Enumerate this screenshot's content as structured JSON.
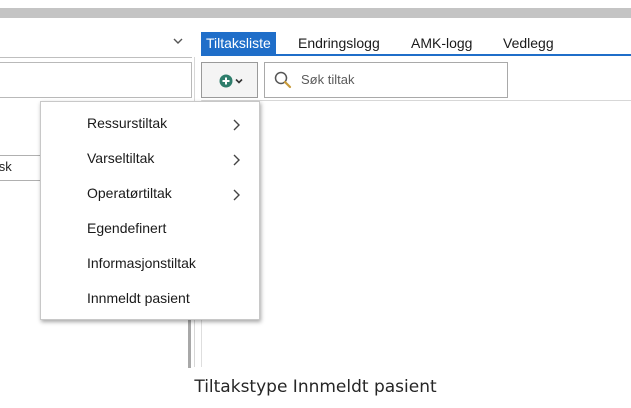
{
  "left_panel": {
    "dropdown_icon": "chevron-down-icon",
    "cell_text": "norsk"
  },
  "tabs": [
    {
      "label": "Tiltaksliste",
      "active": true
    },
    {
      "label": "Endringslogg",
      "active": false
    },
    {
      "label": "AMK-logg",
      "active": false
    },
    {
      "label": "Vedlegg",
      "active": false
    }
  ],
  "toolbar": {
    "add_icon": "plus-circle-icon",
    "add_dropdown_icon": "chevron-down-icon",
    "search_icon": "search-icon",
    "search_placeholder": "Søk tiltak"
  },
  "menu": {
    "items": [
      {
        "label": "Ressurstiltak",
        "has_submenu": true
      },
      {
        "label": "Varseltiltak",
        "has_submenu": true
      },
      {
        "label": "Operatørtiltak",
        "has_submenu": true
      },
      {
        "label": "Egendefinert",
        "has_submenu": false
      },
      {
        "label": "Informasjonstiltak",
        "has_submenu": false
      },
      {
        "label": "Innmeldt pasient",
        "has_submenu": false
      }
    ]
  },
  "caption": "Tiltakstype Innmeldt pasient",
  "colors": {
    "accent": "#1f6ec9",
    "add_icon": "#2e7d6b"
  }
}
